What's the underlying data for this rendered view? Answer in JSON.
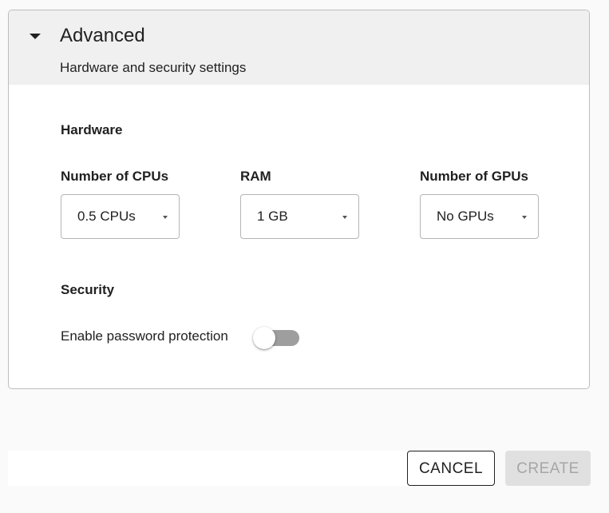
{
  "panel": {
    "title": "Advanced",
    "subtitle": "Hardware and security settings"
  },
  "hardware": {
    "heading": "Hardware",
    "fields": [
      {
        "label": "Number of CPUs",
        "value": "0.5 CPUs"
      },
      {
        "label": "RAM",
        "value": "1 GB"
      },
      {
        "label": "Number of GPUs",
        "value": "No GPUs"
      }
    ]
  },
  "security": {
    "heading": "Security",
    "password_toggle_label": "Enable password protection",
    "password_toggle_on": false
  },
  "actions": {
    "cancel_label": "CANCEL",
    "create_label": "CREATE",
    "create_enabled": false
  },
  "icons": {
    "expand": "caret-down-icon",
    "select": "dropdown-arrow-icon"
  },
  "colors": {
    "header_bg": "#f0f0f0",
    "toggle_track_off": "#9e9e9e",
    "create_disabled_bg": "#e0e0e0",
    "create_disabled_text": "#a6a6a6"
  }
}
